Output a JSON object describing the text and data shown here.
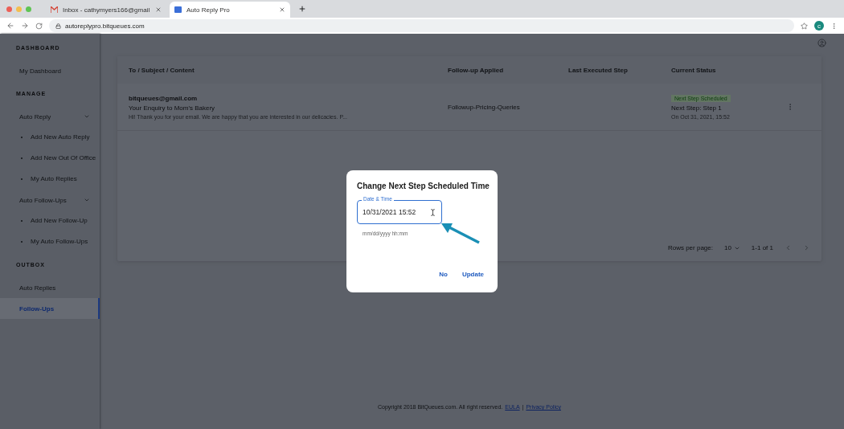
{
  "browser": {
    "tabs": [
      {
        "title": "Inbox - cathymyers166@gmail",
        "selected": false
      },
      {
        "title": "Auto Reply Pro",
        "selected": true
      }
    ],
    "url": "autoreplypro.bitqueues.com",
    "profile": "c"
  },
  "sidebar": {
    "sections": [
      {
        "heading": "DASHBOARD",
        "items": [
          {
            "label": "My Dashboard",
            "selected": false
          }
        ]
      },
      {
        "heading": "MANAGE",
        "items": [
          {
            "label": "Auto Reply",
            "selected": false,
            "expanded": true,
            "children": [
              {
                "label": "Add New Auto Reply"
              },
              {
                "label": "Add New Out Of Office"
              },
              {
                "label": "My Auto Replies"
              }
            ]
          },
          {
            "label": "Auto Follow-Ups",
            "selected": false,
            "expanded": true,
            "children": [
              {
                "label": "Add New Follow-Up"
              },
              {
                "label": "My Auto Follow-Ups"
              }
            ]
          }
        ]
      },
      {
        "heading": "OUTBOX",
        "items": [
          {
            "label": "Auto Replies",
            "selected": false
          },
          {
            "label": "Follow-Ups",
            "selected": true
          }
        ]
      }
    ]
  },
  "table": {
    "columns": [
      "To / Subject / Content",
      "Follow-up Applied",
      "Last Executed Step",
      "Current Status"
    ],
    "rows": [
      {
        "to": "bitqueues@gmail.com",
        "subject": "Your Enquiry to Mom's Bakery",
        "content": "Hi! Thank you for your email. We are happy that you are interested in our delicacies. P...",
        "followup": "Followup-Pricing-Queries",
        "status_badge": "Next Step Scheduled",
        "next_step": "Next Step: Step 1",
        "scheduled": "On Oct 31, 2021, 15:52"
      }
    ],
    "rows_per_page_label": "Rows per page:",
    "rows_per_page": "10",
    "range": "1-1 of 1"
  },
  "dialog": {
    "title": "Change Next Step Scheduled Time",
    "field_label": "Date & Time",
    "value": "10/31/2021 15:52",
    "helper": "mm/dd/yyyy hh:mm",
    "buttons": [
      "No",
      "Update"
    ]
  },
  "footer": {
    "copyright": "Copyright 2018 BitQueues.com. All right reserved.",
    "links": [
      "EULA",
      "Privacy Policy"
    ],
    "separator": "|"
  }
}
